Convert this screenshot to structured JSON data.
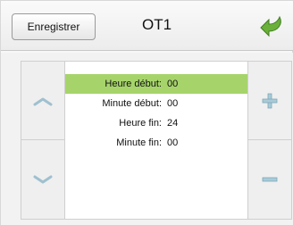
{
  "header": {
    "save_label": "Enregistrer",
    "title": "OT1"
  },
  "rows": [
    {
      "label": "Heure début:",
      "value": "00",
      "selected": true
    },
    {
      "label": "Minute début:",
      "value": "00",
      "selected": false
    },
    {
      "label": "Heure fin:",
      "value": "24",
      "selected": false
    },
    {
      "label": "Minute fin:",
      "value": "00",
      "selected": false
    }
  ],
  "colors": {
    "selection": "#a6d46b",
    "back_arrow": "#6ab03a"
  },
  "icons": {
    "back": "return-arrow-icon",
    "up": "chevron-up-icon",
    "down": "chevron-down-icon",
    "plus": "plus-icon",
    "minus": "minus-icon"
  }
}
